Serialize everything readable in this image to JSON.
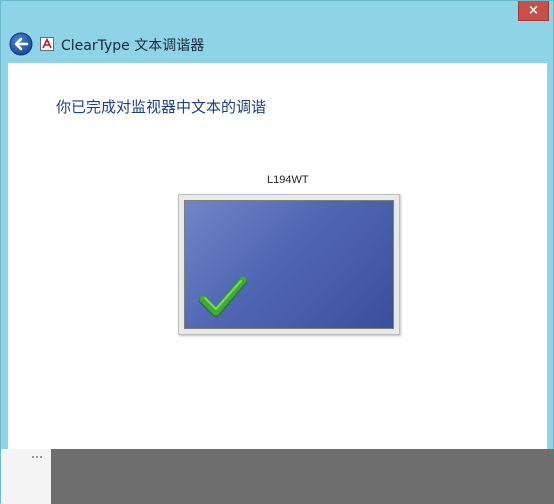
{
  "window": {
    "title": "ClearType 文本调谐器",
    "close_label": "×"
  },
  "content": {
    "heading": "你已完成对监视器中文本的调谐",
    "monitor_name": "L194WT"
  },
  "icons": {
    "back": "back-arrow-icon",
    "app": "cleartype-app-icon",
    "check": "checkmark-icon"
  },
  "colors": {
    "frame": "#8ed3e6",
    "heading": "#1d3f8a",
    "screen": "#4f67b3",
    "check": "#3fae2a",
    "close": "#c7504a"
  }
}
